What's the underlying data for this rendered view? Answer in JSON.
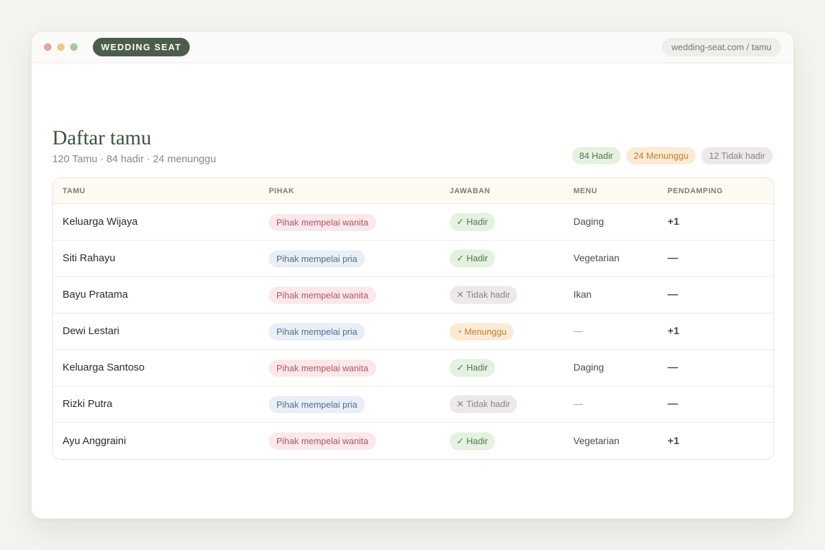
{
  "window": {
    "brand": "WEDDING SEAT",
    "url": "wedding-seat.com / tamu"
  },
  "page": {
    "title": "Daftar tamu",
    "subtitle": "120 Tamu · 84 hadir · 24 menunggu"
  },
  "summary": {
    "hadir": "84 Hadir",
    "menunggu": "24 Menunggu",
    "tidak_hadir": "12 Tidak hadir"
  },
  "colors": {
    "accent": "#4b5e4b",
    "hadir": "#4d7a48",
    "menunggu": "#b88234",
    "tidak_hadir": "#8a8483",
    "wanita": "#b2546a",
    "pria": "#566c88"
  },
  "table": {
    "headers": [
      "TAMU",
      "PIHAK",
      "JAWABAN",
      "MENU",
      "PENDAMPING"
    ],
    "rows": [
      {
        "name": "Keluarga Wijaya",
        "side": "Pihak mempelai wanita",
        "side_type": "wanita",
        "response": "✓ Hadir",
        "response_type": "hadir",
        "menu": "Daging",
        "plus": "+1"
      },
      {
        "name": "Siti Rahayu",
        "side": "Pihak mempelai pria",
        "side_type": "pria",
        "response": "✓ Hadir",
        "response_type": "hadir",
        "menu": "Vegetarian",
        "plus": "—"
      },
      {
        "name": "Bayu Pratama",
        "side": "Pihak mempelai wanita",
        "side_type": "wanita",
        "response": "✕ Tidak hadir",
        "response_type": "tidak",
        "menu": "Ikan",
        "plus": "—"
      },
      {
        "name": "Dewi Lestari",
        "side": "Pihak mempelai pria",
        "side_type": "pria",
        "response": "◔ Menunggu",
        "response_type": "menunggu",
        "menu": "—",
        "plus": "+1"
      },
      {
        "name": "Keluarga Santoso",
        "side": "Pihak mempelai wanita",
        "side_type": "wanita",
        "response": "✓ Hadir",
        "response_type": "hadir",
        "menu": "Daging",
        "plus": "—"
      },
      {
        "name": "Rizki Putra",
        "side": "Pihak mempelai pria",
        "side_type": "pria",
        "response": "✕ Tidak hadir",
        "response_type": "tidak",
        "menu": "—",
        "plus": "—"
      },
      {
        "name": "Ayu Anggraini",
        "side": "Pihak mempelai wanita",
        "side_type": "wanita",
        "response": "✓ Hadir",
        "response_type": "hadir",
        "menu": "Vegetarian",
        "plus": "+1"
      }
    ]
  }
}
